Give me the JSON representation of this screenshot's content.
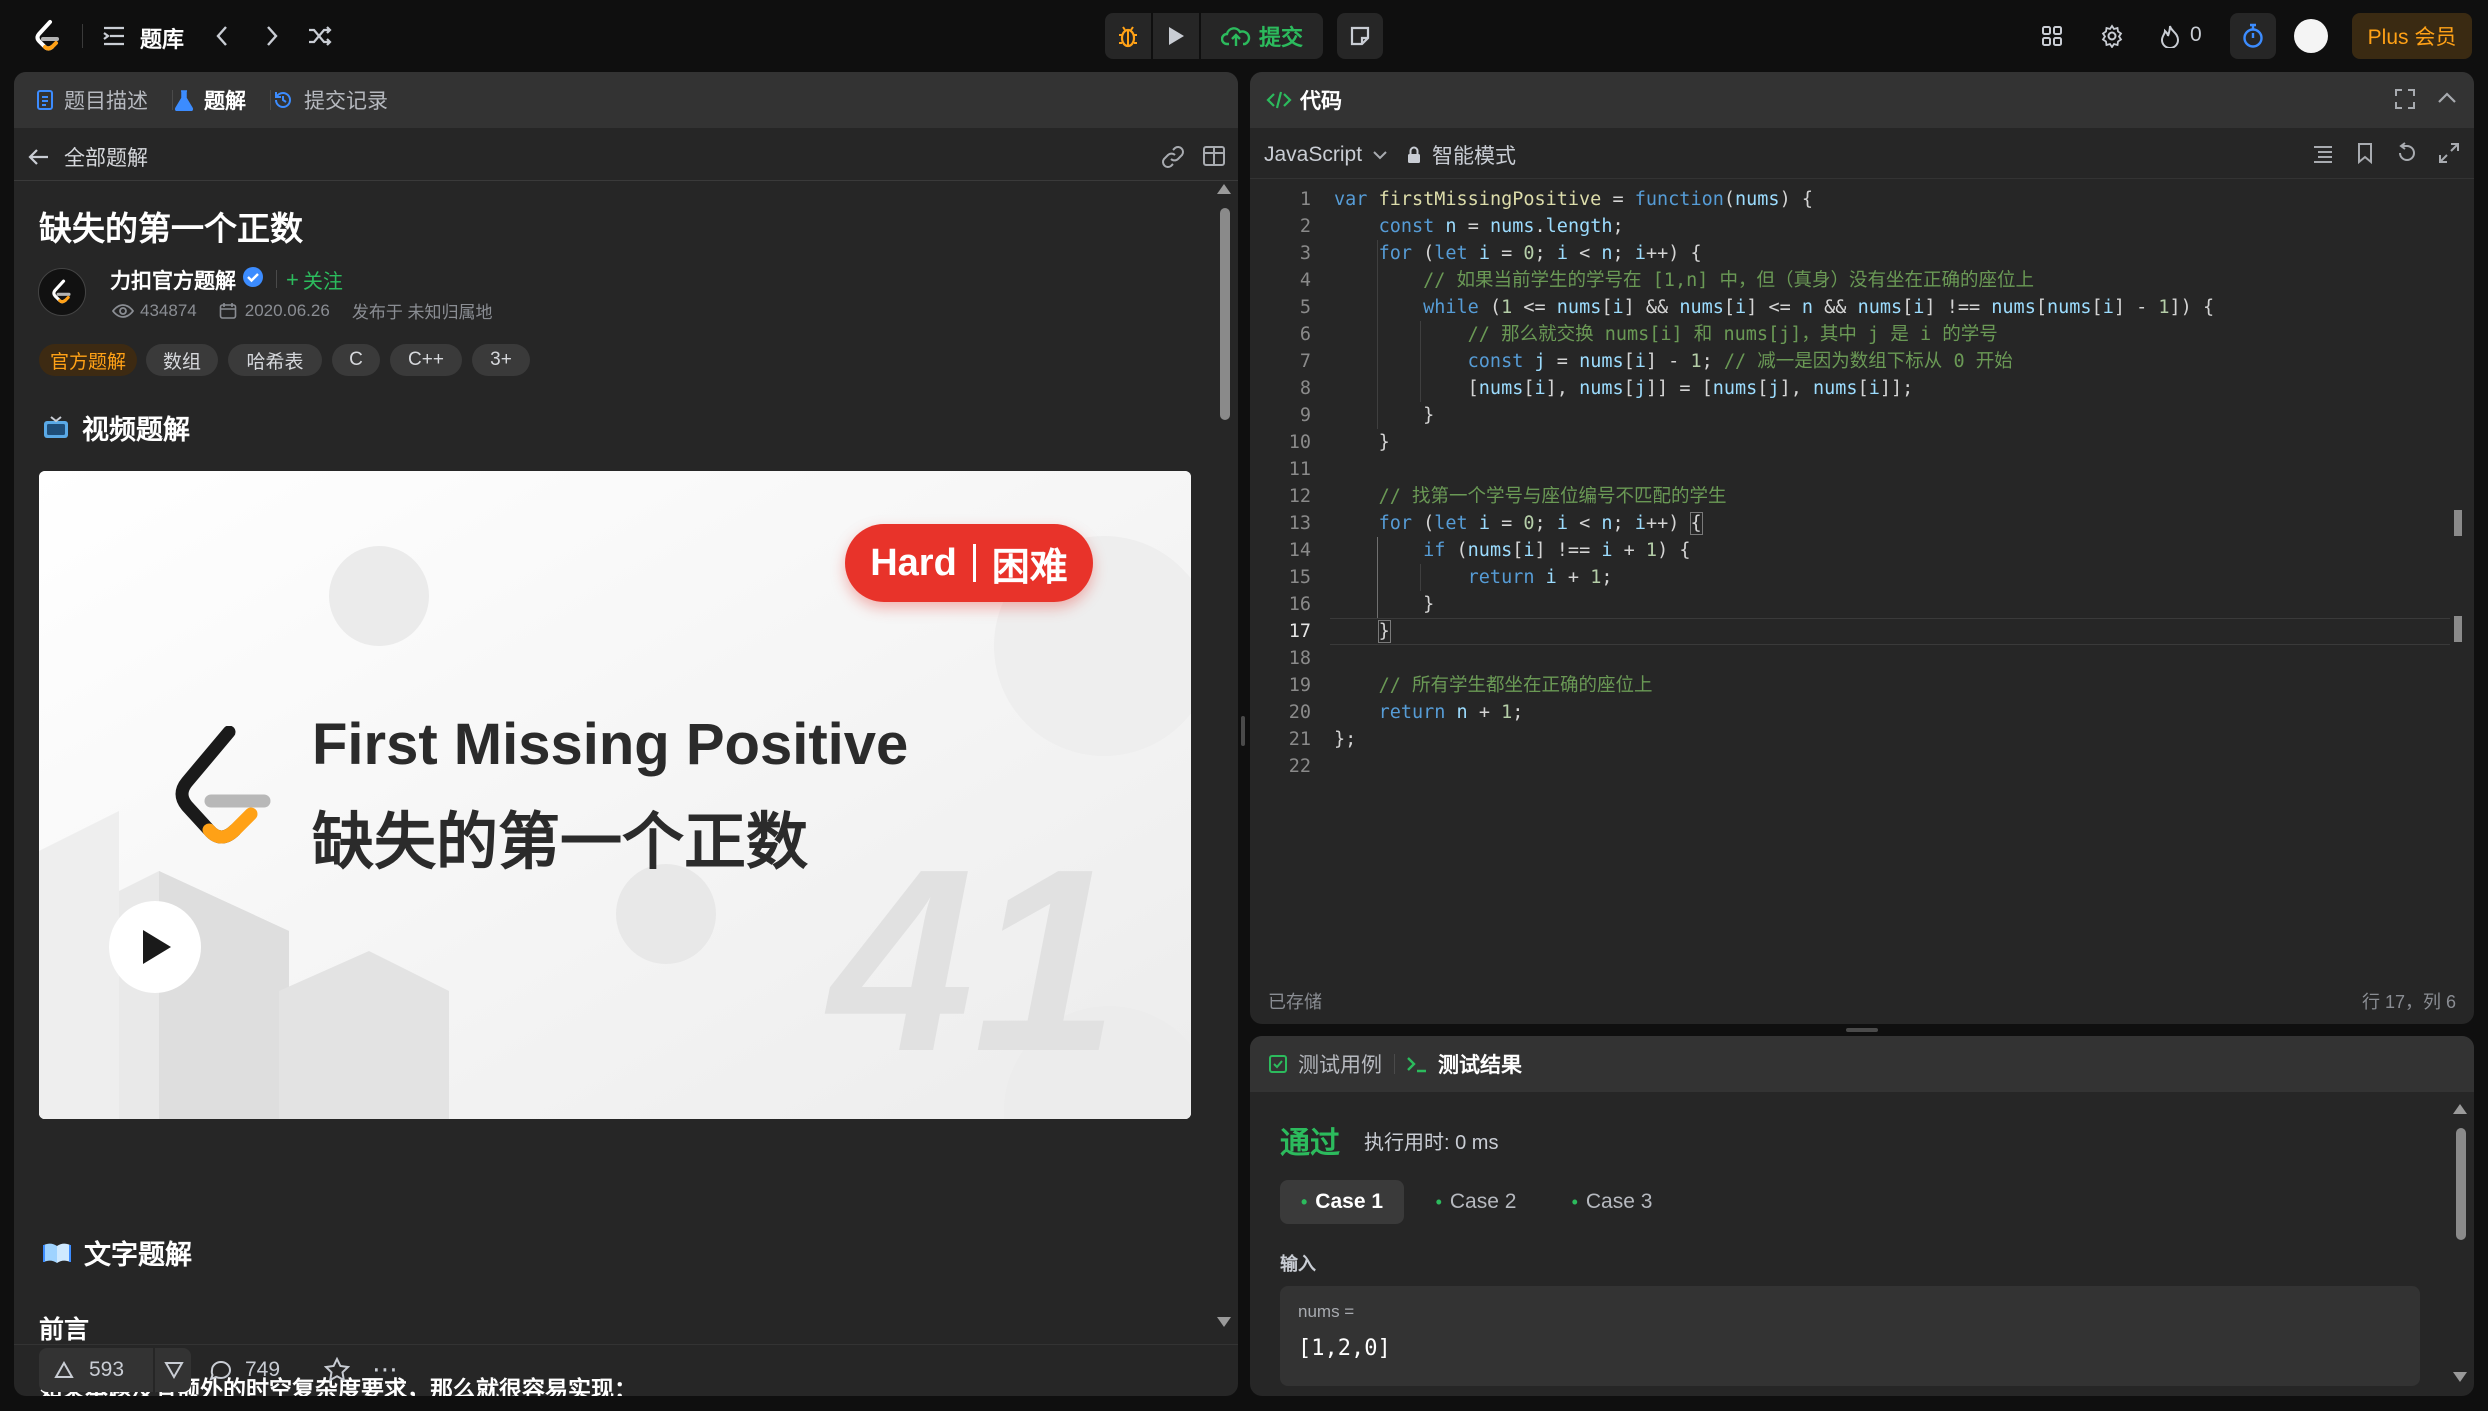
{
  "topbar": {
    "problem_list_label": "题库",
    "submit_label": "提交",
    "streak_count": "0",
    "plus_label": "Plus 会员"
  },
  "left_panel": {
    "tabs": [
      {
        "label": "题目描述",
        "icon": "description-icon"
      },
      {
        "label": "题解",
        "icon": "flask-icon"
      },
      {
        "label": "提交记录",
        "icon": "history-icon"
      }
    ],
    "back_label": "全部题解",
    "solution_title": "缺失的第一个正数",
    "author": "力扣官方题解",
    "follow_label": "关注",
    "views": "434874",
    "date": "2020.06.26",
    "location": "发布于 未知归属地",
    "tags": [
      "官方题解",
      "数组",
      "哈希表",
      "C",
      "C++",
      "3+"
    ],
    "video_section_title": "视频题解",
    "video": {
      "badge_en": "Hard",
      "badge_zh": "困难",
      "title_en": "First Missing Positive",
      "title_zh": "缺失的第一个正数",
      "number": "41"
    },
    "text_section_title": "文字题解",
    "foreword_title": "前言",
    "foreword_text": "如果本题没有额外的时空复杂度要求，那么就很容易实现：",
    "upvotes": "593",
    "comments": "749"
  },
  "code_panel": {
    "title": "代码",
    "language": "JavaScript",
    "mode_label": "智能模式",
    "status": "已存储",
    "cursor_position": "行 17，列 6",
    "line_numbers": [
      "1",
      "2",
      "3",
      "4",
      "5",
      "6",
      "7",
      "8",
      "9",
      "10",
      "11",
      "12",
      "13",
      "14",
      "15",
      "16",
      "17",
      "18",
      "19",
      "20",
      "21",
      "22"
    ]
  },
  "test_panel": {
    "tabs": [
      {
        "label": "测试用例",
        "icon": "checkbox-icon"
      },
      {
        "label": "测试结果",
        "icon": "terminal-icon"
      }
    ],
    "result": "通过",
    "runtime": "执行用时: 0 ms",
    "cases": [
      "Case 1",
      "Case 2",
      "Case 3"
    ],
    "input_label": "输入",
    "input_var": "nums =",
    "input_value": "[1,2,0]"
  }
}
